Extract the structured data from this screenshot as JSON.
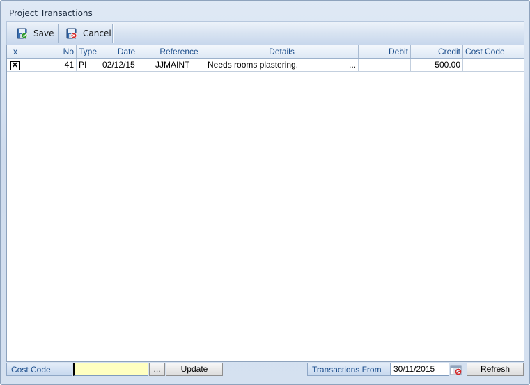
{
  "window": {
    "title": "Project Transactions"
  },
  "toolbar": {
    "save_label": "Save",
    "cancel_label": "Cancel"
  },
  "grid": {
    "columns": [
      "x",
      "No",
      "Type",
      "Date",
      "Reference",
      "Details",
      "Debit",
      "Credit",
      "Cost Code"
    ],
    "rows": [
      {
        "checked": "✕",
        "no": "41",
        "type": "PI",
        "date": "02/12/15",
        "reference": "JJMAINT",
        "details": "Needs rooms plastering.",
        "details_more": "...",
        "debit": "",
        "credit": "500.00",
        "cost_code": ""
      }
    ]
  },
  "footer": {
    "cost_code_label": "Cost Code",
    "cost_code_value": "",
    "browse_label": "...",
    "update_label": "Update",
    "transactions_from_label": "Transactions From",
    "transactions_from_value": "30/11/2015",
    "refresh_label": "Refresh"
  },
  "colors": {
    "header_text": "#1c4e8c",
    "input_highlight": "#ffffc0"
  },
  "icons": {
    "save": "save-disk-icon",
    "cancel": "cancel-disk-icon",
    "calendar": "calendar-icon"
  }
}
